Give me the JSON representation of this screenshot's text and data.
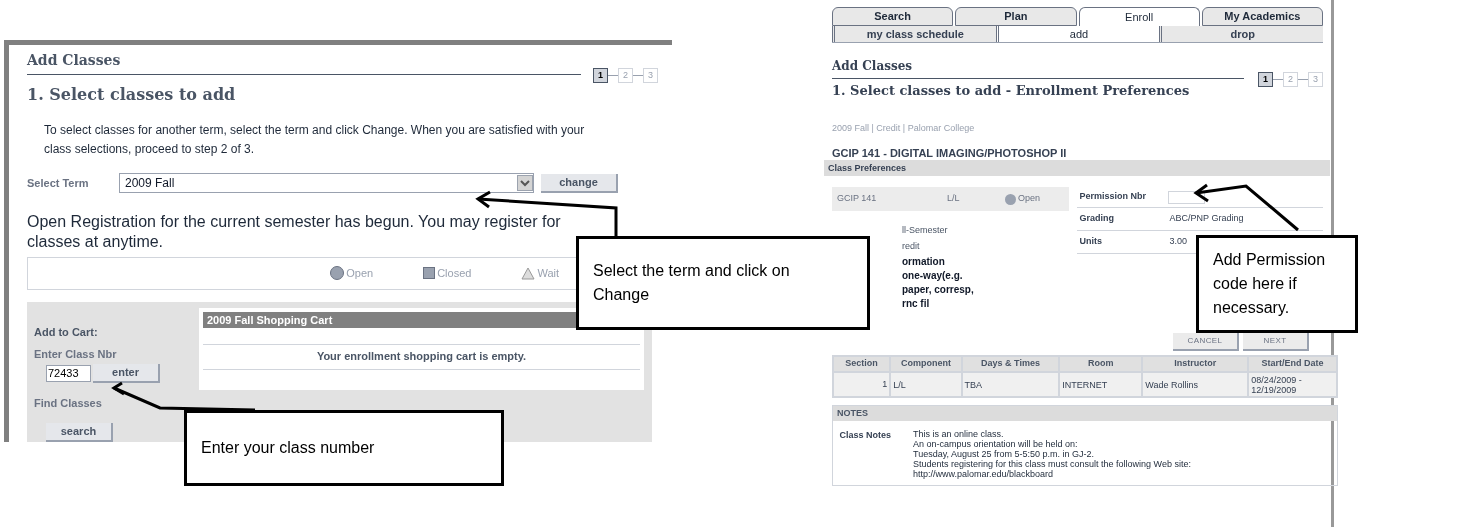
{
  "left_screen": {
    "title": "Add Classes",
    "steps": [
      {
        "label": "1",
        "selected": true
      },
      {
        "label": "2",
        "selected": false
      },
      {
        "label": "3",
        "selected": false
      }
    ],
    "heading": "1.  Select classes to add",
    "instructions": "To select classes for another term, select the term and click Change.  When you are satisfied with your class selections, proceed to step 2 of 3.",
    "term_label": "Select Term",
    "term_value": "2009 Fall",
    "change_button": "change",
    "announcement": "Open Registration for the current semester has begun. You may register for classes at anytime.",
    "legend": [
      {
        "kind": "circle",
        "label": "Open"
      },
      {
        "kind": "square",
        "label": "Closed"
      },
      {
        "kind": "triangle",
        "label": "Wait"
      }
    ],
    "add_to_cart": {
      "title": "Add to Cart:",
      "class_nbr_label": "Enter Class Nbr",
      "class_nbr_value": "72433",
      "enter_button": "enter",
      "find_label": "Find Classes",
      "search_button": "search"
    },
    "cart": {
      "title": "2009 Fall Shopping Cart",
      "message": "Your enrollment shopping cart is empty."
    }
  },
  "right_screen": {
    "tabs": [
      {
        "label": "Search",
        "selected": false
      },
      {
        "label": "Plan",
        "selected": false
      },
      {
        "label": "Enroll",
        "selected": true
      },
      {
        "label": "My Academics",
        "selected": false
      }
    ],
    "subtabs": [
      {
        "label": "my class schedule",
        "selected": false
      },
      {
        "label": "add",
        "selected": true
      },
      {
        "label": "drop",
        "selected": false
      }
    ],
    "title": "Add Classes",
    "steps": [
      {
        "label": "1",
        "selected": true
      },
      {
        "label": "2",
        "selected": false
      },
      {
        "label": "3",
        "selected": false
      }
    ],
    "heading": "1.  Select classes to add - Enrollment Preferences",
    "term_info": "2009 Fall | Credit | Palomar College",
    "course_title": "GCIP  141 - DIGITAL IMAGING/PHOTOSHOP II",
    "preferences": {
      "title": "Class Preferences",
      "section": "GCIP 141",
      "component": "L/L",
      "status": "Open",
      "permission_label": "Permission Nbr",
      "grading_label": "Grading",
      "grading_value": "ABC/PNP Grading",
      "units_label": "Units",
      "units_value": "3.00",
      "partial_lines": [
        {
          "text": "ll-Semester",
          "bold": false
        },
        {
          "text": "redit",
          "bold": false
        },
        {
          "text": "ormation",
          "bold": true
        },
        {
          "text": "one-way(e.g.",
          "bold": true
        },
        {
          "text": "paper, corresp,",
          "bold": true
        },
        {
          "text": "rnc fil",
          "bold": true
        }
      ]
    },
    "buttons": [
      "CANCEL",
      "NEXT"
    ],
    "table": {
      "columns": [
        "Section",
        "Component",
        "Days & Times",
        "Room",
        "Instructor",
        "Start/End Date"
      ],
      "rows": [
        [
          "1",
          "L/L",
          "TBA",
          "INTERNET",
          "Wade Rollins",
          "08/24/2009 - 12/19/2009"
        ]
      ]
    },
    "notes": {
      "title": "NOTES",
      "label": "Class Notes",
      "lines": [
        "This is an online class.",
        "An on-campus orientation will be held on:",
        "Tuesday, August 25 from 5-5:50 p.m. in GJ-2.",
        "Students registering for this class must consult the following Web site:",
        "http://www.palomar.edu/blackboard"
      ]
    }
  },
  "callouts": [
    {
      "text": "Select the term and click on Change"
    },
    {
      "text": "Enter your class number"
    },
    {
      "text": "Add Permission code here if necessary."
    }
  ]
}
